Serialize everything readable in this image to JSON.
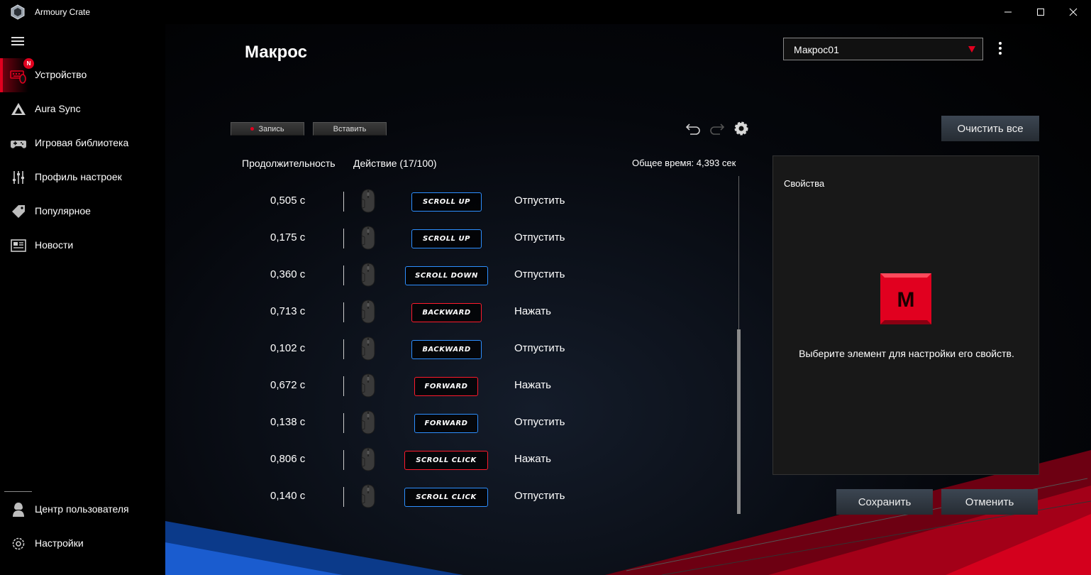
{
  "window": {
    "title": "Armoury Crate",
    "controls": [
      "minimize-icon",
      "maximize-icon",
      "close-icon"
    ]
  },
  "sidebar": {
    "items": [
      {
        "label": "Устройство",
        "icon": "keyboard-mouse-icon",
        "active": true,
        "badge": "N"
      },
      {
        "label": "Aura Sync",
        "icon": "aura-triangle-icon"
      },
      {
        "label": "Игровая библиотека",
        "icon": "gamepad-icon"
      },
      {
        "label": "Профиль настроек",
        "icon": "sliders-icon"
      },
      {
        "label": "Популярное",
        "icon": "tag-icon"
      },
      {
        "label": "Новости",
        "icon": "newspaper-icon"
      }
    ],
    "bottom_items": [
      {
        "label": "Центр пользователя",
        "icon": "user-icon"
      },
      {
        "label": "Настройки",
        "icon": "gear-icon"
      }
    ]
  },
  "main": {
    "title": "Макрос",
    "macro_select": {
      "value": "Макрос01"
    },
    "toolbar": {
      "record_label": "Запись",
      "insert_label": "Вставить",
      "clear_label": "Очистить все"
    },
    "columns": {
      "duration": "Продолжительность",
      "action": "Действие (17/100)"
    },
    "total_time": "Общее время: 4,393 сек",
    "rows": [
      {
        "duration": "0,505 с",
        "key": "SCROLL UP",
        "key_color": "blue",
        "action": "Отпустить"
      },
      {
        "duration": "0,175 с",
        "key": "SCROLL UP",
        "key_color": "blue",
        "action": "Отпустить"
      },
      {
        "duration": "0,360 с",
        "key": "SCROLL DOWN",
        "key_color": "blue",
        "action": "Отпустить"
      },
      {
        "duration": "0,713 с",
        "key": "BACKWARD",
        "key_color": "red",
        "action": "Нажать"
      },
      {
        "duration": "0,102 с",
        "key": "BACKWARD",
        "key_color": "blue",
        "action": "Отпустить"
      },
      {
        "duration": "0,672 с",
        "key": "FORWARD",
        "key_color": "red",
        "action": "Нажать"
      },
      {
        "duration": "0,138 с",
        "key": "FORWARD",
        "key_color": "blue",
        "action": "Отпустить"
      },
      {
        "duration": "0,806 с",
        "key": "SCROLL CLICK",
        "key_color": "red",
        "action": "Нажать"
      },
      {
        "duration": "0,140 с",
        "key": "SCROLL CLICK",
        "key_color": "blue",
        "action": "Отпустить"
      }
    ],
    "properties": {
      "title": "Свойства",
      "icon_letter": "M",
      "message": "Выберите элемент для настройки его свойств."
    },
    "save_label": "Сохранить",
    "cancel_label": "Отменить"
  },
  "colors": {
    "accent_red": "#e1001f",
    "key_blue": "#2d8fff",
    "key_red": "#ff1a2c"
  }
}
